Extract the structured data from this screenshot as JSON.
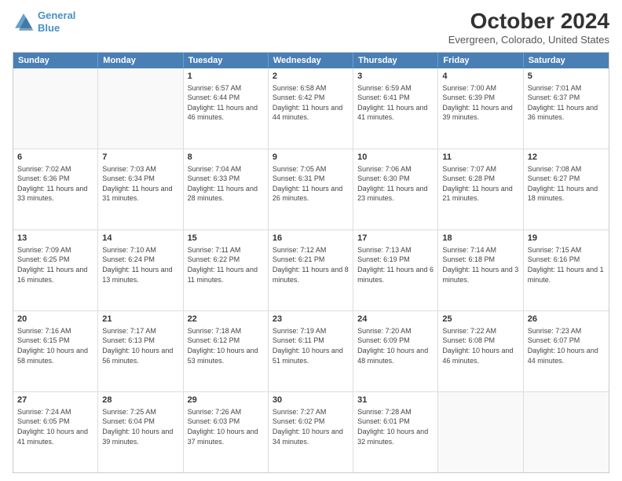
{
  "header": {
    "logo_line1": "General",
    "logo_line2": "Blue",
    "title": "October 2024",
    "subtitle": "Evergreen, Colorado, United States"
  },
  "weekdays": [
    "Sunday",
    "Monday",
    "Tuesday",
    "Wednesday",
    "Thursday",
    "Friday",
    "Saturday"
  ],
  "rows": [
    [
      {
        "day": "",
        "sunrise": "",
        "sunset": "",
        "daylight": ""
      },
      {
        "day": "",
        "sunrise": "",
        "sunset": "",
        "daylight": ""
      },
      {
        "day": "1",
        "sunrise": "Sunrise: 6:57 AM",
        "sunset": "Sunset: 6:44 PM",
        "daylight": "Daylight: 11 hours and 46 minutes."
      },
      {
        "day": "2",
        "sunrise": "Sunrise: 6:58 AM",
        "sunset": "Sunset: 6:42 PM",
        "daylight": "Daylight: 11 hours and 44 minutes."
      },
      {
        "day": "3",
        "sunrise": "Sunrise: 6:59 AM",
        "sunset": "Sunset: 6:41 PM",
        "daylight": "Daylight: 11 hours and 41 minutes."
      },
      {
        "day": "4",
        "sunrise": "Sunrise: 7:00 AM",
        "sunset": "Sunset: 6:39 PM",
        "daylight": "Daylight: 11 hours and 39 minutes."
      },
      {
        "day": "5",
        "sunrise": "Sunrise: 7:01 AM",
        "sunset": "Sunset: 6:37 PM",
        "daylight": "Daylight: 11 hours and 36 minutes."
      }
    ],
    [
      {
        "day": "6",
        "sunrise": "Sunrise: 7:02 AM",
        "sunset": "Sunset: 6:36 PM",
        "daylight": "Daylight: 11 hours and 33 minutes."
      },
      {
        "day": "7",
        "sunrise": "Sunrise: 7:03 AM",
        "sunset": "Sunset: 6:34 PM",
        "daylight": "Daylight: 11 hours and 31 minutes."
      },
      {
        "day": "8",
        "sunrise": "Sunrise: 7:04 AM",
        "sunset": "Sunset: 6:33 PM",
        "daylight": "Daylight: 11 hours and 28 minutes."
      },
      {
        "day": "9",
        "sunrise": "Sunrise: 7:05 AM",
        "sunset": "Sunset: 6:31 PM",
        "daylight": "Daylight: 11 hours and 26 minutes."
      },
      {
        "day": "10",
        "sunrise": "Sunrise: 7:06 AM",
        "sunset": "Sunset: 6:30 PM",
        "daylight": "Daylight: 11 hours and 23 minutes."
      },
      {
        "day": "11",
        "sunrise": "Sunrise: 7:07 AM",
        "sunset": "Sunset: 6:28 PM",
        "daylight": "Daylight: 11 hours and 21 minutes."
      },
      {
        "day": "12",
        "sunrise": "Sunrise: 7:08 AM",
        "sunset": "Sunset: 6:27 PM",
        "daylight": "Daylight: 11 hours and 18 minutes."
      }
    ],
    [
      {
        "day": "13",
        "sunrise": "Sunrise: 7:09 AM",
        "sunset": "Sunset: 6:25 PM",
        "daylight": "Daylight: 11 hours and 16 minutes."
      },
      {
        "day": "14",
        "sunrise": "Sunrise: 7:10 AM",
        "sunset": "Sunset: 6:24 PM",
        "daylight": "Daylight: 11 hours and 13 minutes."
      },
      {
        "day": "15",
        "sunrise": "Sunrise: 7:11 AM",
        "sunset": "Sunset: 6:22 PM",
        "daylight": "Daylight: 11 hours and 11 minutes."
      },
      {
        "day": "16",
        "sunrise": "Sunrise: 7:12 AM",
        "sunset": "Sunset: 6:21 PM",
        "daylight": "Daylight: 11 hours and 8 minutes."
      },
      {
        "day": "17",
        "sunrise": "Sunrise: 7:13 AM",
        "sunset": "Sunset: 6:19 PM",
        "daylight": "Daylight: 11 hours and 6 minutes."
      },
      {
        "day": "18",
        "sunrise": "Sunrise: 7:14 AM",
        "sunset": "Sunset: 6:18 PM",
        "daylight": "Daylight: 11 hours and 3 minutes."
      },
      {
        "day": "19",
        "sunrise": "Sunrise: 7:15 AM",
        "sunset": "Sunset: 6:16 PM",
        "daylight": "Daylight: 11 hours and 1 minute."
      }
    ],
    [
      {
        "day": "20",
        "sunrise": "Sunrise: 7:16 AM",
        "sunset": "Sunset: 6:15 PM",
        "daylight": "Daylight: 10 hours and 58 minutes."
      },
      {
        "day": "21",
        "sunrise": "Sunrise: 7:17 AM",
        "sunset": "Sunset: 6:13 PM",
        "daylight": "Daylight: 10 hours and 56 minutes."
      },
      {
        "day": "22",
        "sunrise": "Sunrise: 7:18 AM",
        "sunset": "Sunset: 6:12 PM",
        "daylight": "Daylight: 10 hours and 53 minutes."
      },
      {
        "day": "23",
        "sunrise": "Sunrise: 7:19 AM",
        "sunset": "Sunset: 6:11 PM",
        "daylight": "Daylight: 10 hours and 51 minutes."
      },
      {
        "day": "24",
        "sunrise": "Sunrise: 7:20 AM",
        "sunset": "Sunset: 6:09 PM",
        "daylight": "Daylight: 10 hours and 48 minutes."
      },
      {
        "day": "25",
        "sunrise": "Sunrise: 7:22 AM",
        "sunset": "Sunset: 6:08 PM",
        "daylight": "Daylight: 10 hours and 46 minutes."
      },
      {
        "day": "26",
        "sunrise": "Sunrise: 7:23 AM",
        "sunset": "Sunset: 6:07 PM",
        "daylight": "Daylight: 10 hours and 44 minutes."
      }
    ],
    [
      {
        "day": "27",
        "sunrise": "Sunrise: 7:24 AM",
        "sunset": "Sunset: 6:05 PM",
        "daylight": "Daylight: 10 hours and 41 minutes."
      },
      {
        "day": "28",
        "sunrise": "Sunrise: 7:25 AM",
        "sunset": "Sunset: 6:04 PM",
        "daylight": "Daylight: 10 hours and 39 minutes."
      },
      {
        "day": "29",
        "sunrise": "Sunrise: 7:26 AM",
        "sunset": "Sunset: 6:03 PM",
        "daylight": "Daylight: 10 hours and 37 minutes."
      },
      {
        "day": "30",
        "sunrise": "Sunrise: 7:27 AM",
        "sunset": "Sunset: 6:02 PM",
        "daylight": "Daylight: 10 hours and 34 minutes."
      },
      {
        "day": "31",
        "sunrise": "Sunrise: 7:28 AM",
        "sunset": "Sunset: 6:01 PM",
        "daylight": "Daylight: 10 hours and 32 minutes."
      },
      {
        "day": "",
        "sunrise": "",
        "sunset": "",
        "daylight": ""
      },
      {
        "day": "",
        "sunrise": "",
        "sunset": "",
        "daylight": ""
      }
    ]
  ]
}
